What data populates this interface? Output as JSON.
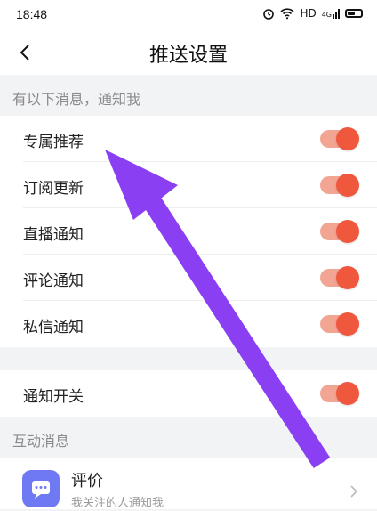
{
  "status_bar": {
    "time": "18:48",
    "hd": "HD",
    "signal": "4G",
    "icons": [
      "alarm-icon",
      "wifi-icon",
      "signal-icon",
      "battery-icon"
    ]
  },
  "app_bar": {
    "title": "推送设置",
    "back_icon": "back-arrow-icon"
  },
  "section_notify": {
    "header": "有以下消息，通知我",
    "items": [
      {
        "label": "专属推荐",
        "on": true
      },
      {
        "label": "订阅更新",
        "on": true
      },
      {
        "label": "直播通知",
        "on": true
      },
      {
        "label": "评论通知",
        "on": true
      },
      {
        "label": "私信通知",
        "on": true
      }
    ]
  },
  "master_switch": {
    "label": "通知开关",
    "on": true
  },
  "section_interaction": {
    "header": "互动消息",
    "review": {
      "title": "评价",
      "subtitle": "我关注的人通知我",
      "icon": "chat-bubble-icon"
    }
  },
  "colors": {
    "toggle_knob": "#f0583e",
    "toggle_track": "#f3a594",
    "annotation_arrow": "#8a3ff2",
    "review_icon_bg": "#6f79f3"
  }
}
